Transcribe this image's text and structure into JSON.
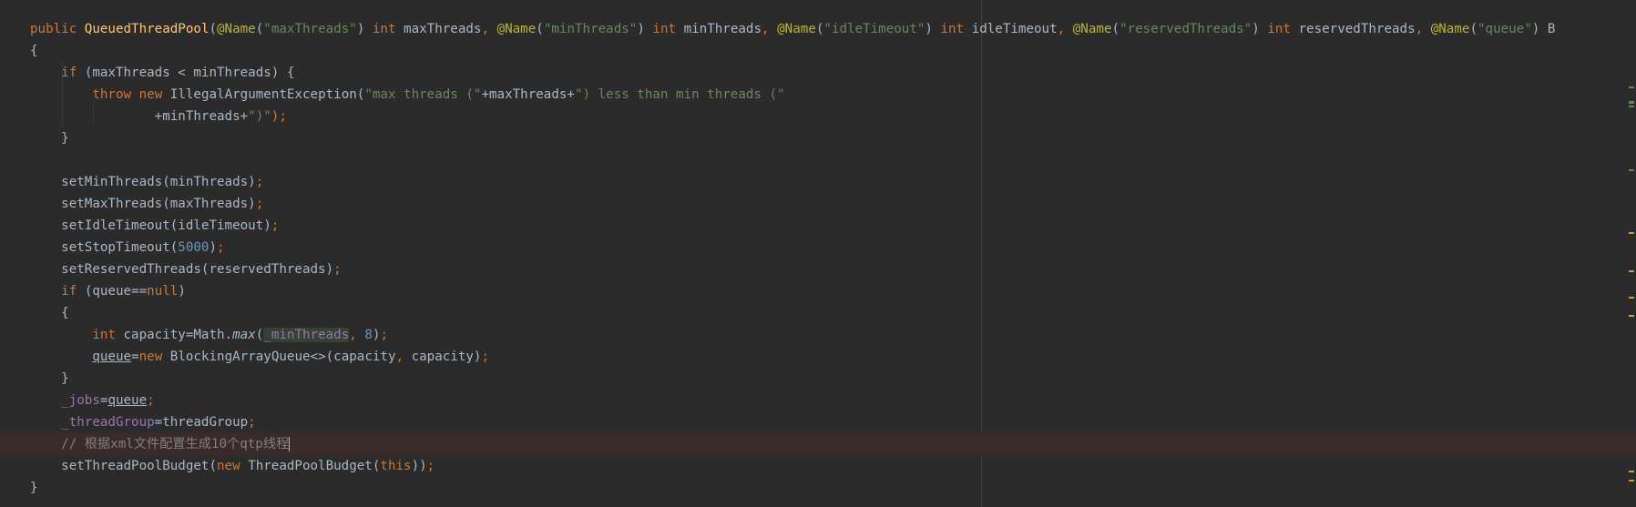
{
  "editor": {
    "constructor_line": {
      "modifier": "public",
      "name": "QueuedThreadPool",
      "p1_ann": "@Name",
      "p1_str": "\"maxThreads\"",
      "p1_type": "int",
      "p1_name": "maxThreads",
      "p2_ann": "@Name",
      "p2_str": "\"minThreads\"",
      "p2_type": "int",
      "p2_name": "minThreads",
      "p3_ann": "@Name",
      "p3_str": "\"idleTimeout\"",
      "p3_type": "int",
      "p3_name": "idleTimeout",
      "p4_ann": "@Name",
      "p4_str": "\"reservedThreads\"",
      "p4_type": "int",
      "p4_name": "reservedThreads",
      "p5_ann": "@Name",
      "p5_str": "\"queue\"",
      "tail": "B"
    },
    "open_brace": "{",
    "if1": {
      "kw": "if",
      "cond": "(maxThreads < minThreads) {"
    },
    "throw_line": {
      "throw": "throw",
      "new": "new",
      "type": "IllegalArgumentException(",
      "str1": "\"max threads (\"",
      "mid": "+maxThreads+",
      "str2": "\") less than min threads (\""
    },
    "throw_cont": {
      "expr": "+minThreads+",
      "str": "\")\"",
      "end": ");"
    },
    "close_if1": "}",
    "calls": [
      {
        "text": "setMinThreads(minThreads)",
        "semi": ";"
      },
      {
        "text": "setMaxThreads(maxThreads)",
        "semi": ";"
      },
      {
        "text": "setIdleTimeout(idleTimeout)",
        "semi": ";"
      }
    ],
    "stop_timeout": {
      "pre": "setStopTimeout(",
      "num": "5000",
      "post": ")",
      "semi": ";"
    },
    "reserved": {
      "text": "setReservedThreads(reservedThreads)",
      "semi": ";"
    },
    "if2": {
      "kw": "if",
      "pre": "(queue==",
      "null": "null",
      "post": ")"
    },
    "if2_open": "{",
    "capacity_line": {
      "type": "int",
      "pre": "capacity=Math.",
      "method": "max",
      "paren": "(",
      "field": "_minThreads",
      "comma": ",",
      "num": "8",
      "post": ")",
      "semi": ";"
    },
    "queue_line": {
      "var": "queue",
      "eq": "=",
      "new": "new",
      "type": "BlockingArrayQueue<>(capacity",
      "comma": ",",
      "post": "capacity)",
      "semi": ";"
    },
    "if2_close": "}",
    "jobs_line": {
      "field": "_jobs",
      "eq": "=",
      "var": "queue",
      "semi": ";"
    },
    "group_line": {
      "field": "_threadGroup",
      "post": "=threadGroup",
      "semi": ";"
    },
    "comment_line": "// 根据xml文件配置生成10个qtp线程",
    "budget_line": {
      "pre": "setThreadPoolBudget(",
      "new": "new",
      "type": "ThreadPoolBudget(",
      "this": "this",
      "post": "))",
      "semi": ";"
    },
    "close_brace": "}"
  },
  "colors": {
    "background": "#2b2b2b",
    "keyword": "#cc7832",
    "annotation": "#bbb529",
    "string": "#6a8759",
    "number": "#6897bb",
    "field": "#9876aa",
    "comment": "#808080"
  },
  "icons": {
    "gutter": "lightbulb-icon"
  }
}
